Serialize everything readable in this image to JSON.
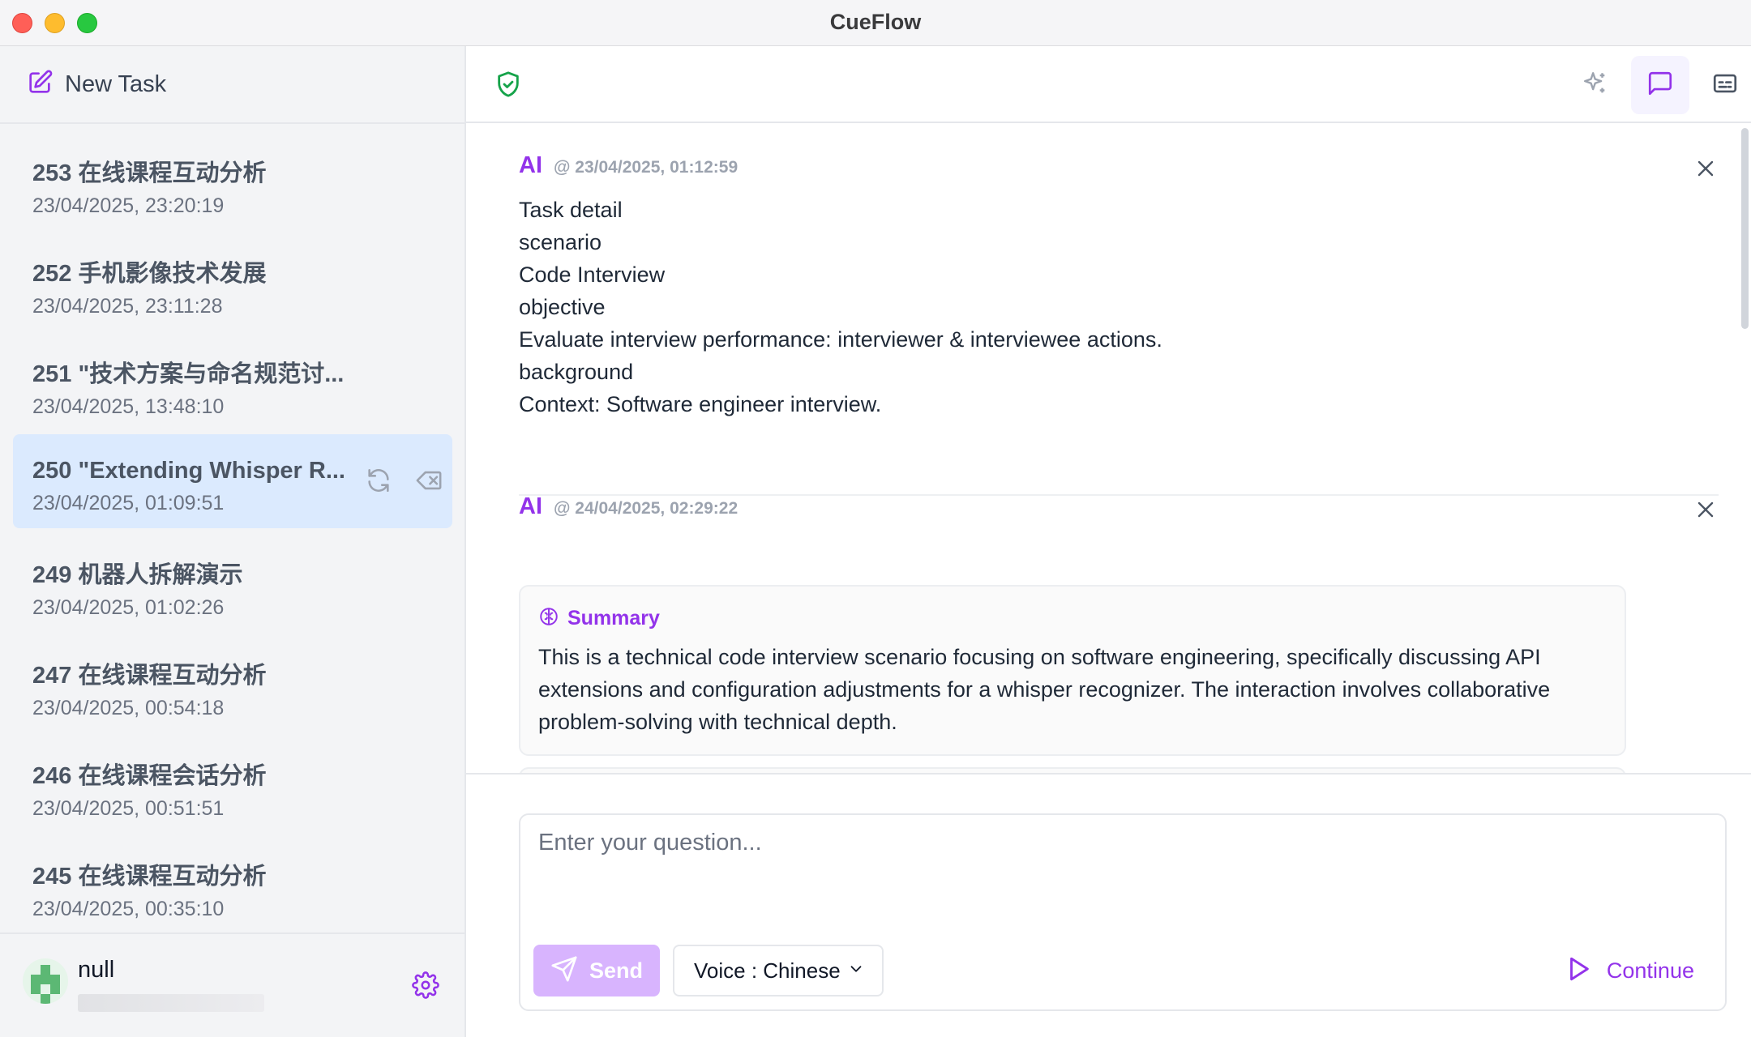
{
  "window": {
    "title": "CueFlow"
  },
  "colors": {
    "accent": "#9333ea",
    "active_bg": "#dbeafe",
    "send_bg": "#d8b4fe",
    "shield": "#16a34a"
  },
  "sidebar": {
    "new_task_label": "New Task",
    "tasks": [
      {
        "title": "253 在线课程互动分析",
        "date": "23/04/2025, 23:20:19",
        "active": false
      },
      {
        "title": "252 手机影像技术发展",
        "date": "23/04/2025, 23:11:28",
        "active": false
      },
      {
        "title": "251 \"技术方案与命名规范讨...",
        "date": "23/04/2025, 13:48:10",
        "active": false
      },
      {
        "title": "250 \"Extending Whisper R...",
        "date": "23/04/2025, 01:09:51",
        "active": true
      },
      {
        "title": "249 机器人拆解演示",
        "date": "23/04/2025, 01:02:26",
        "active": false
      },
      {
        "title": "247 在线课程互动分析",
        "date": "23/04/2025, 00:54:18",
        "active": false
      },
      {
        "title": "246 在线课程会话分析",
        "date": "23/04/2025, 00:51:51",
        "active": false
      },
      {
        "title": "245 在线课程互动分析",
        "date": "23/04/2025, 00:35:10",
        "active": false
      }
    ],
    "user": {
      "name": "null"
    }
  },
  "main": {
    "messages": [
      {
        "author": "AI",
        "time": "@ 23/04/2025, 01:12:59",
        "lines": [
          "Task detail",
          "scenario",
          "Code Interview",
          "objective",
          "Evaluate interview performance: interviewer & interviewee actions.",
          "background",
          "Context: Software engineer interview."
        ]
      },
      {
        "author": "AI",
        "time": "@ 24/04/2025, 02:29:22",
        "summary_label": "Summary",
        "summary_text": "This is a technical code interview scenario focusing on software engineering, specifically discussing API extensions and configuration adjustments for a whisper recognizer. The interaction involves collaborative problem-solving with technical depth."
      }
    ],
    "input": {
      "placeholder": "Enter your question...",
      "value": "",
      "send_label": "Send",
      "voice_label": "Voice : Chinese",
      "continue_label": "Continue"
    }
  }
}
